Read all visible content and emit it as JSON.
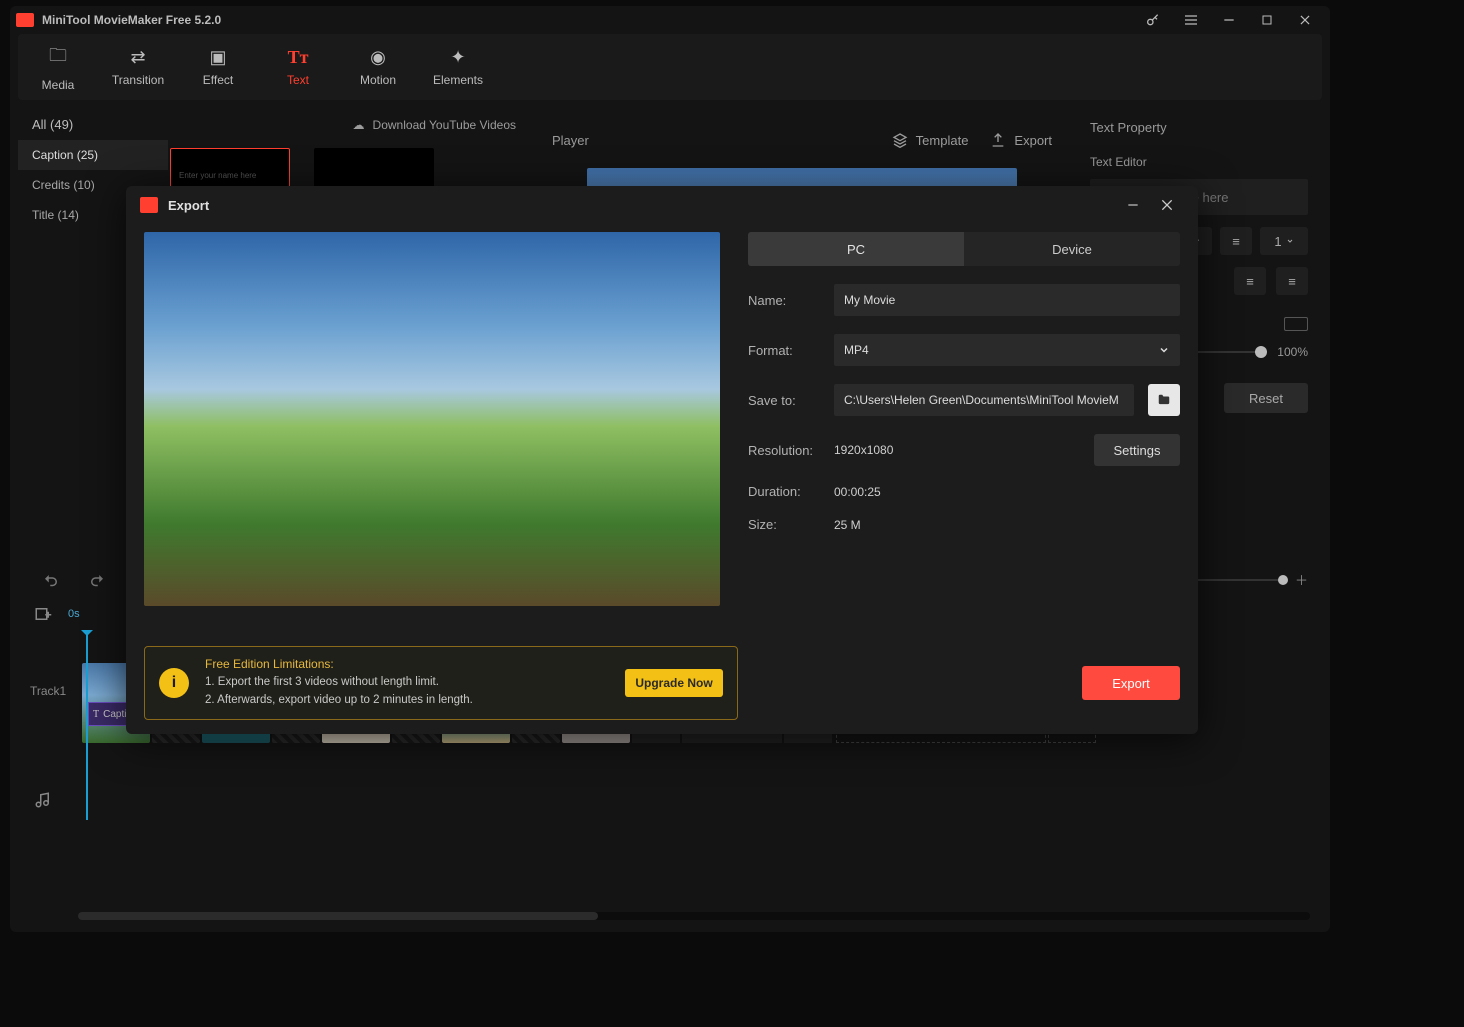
{
  "title": "MiniTool MovieMaker Free 5.2.0",
  "toolbar": {
    "items": [
      {
        "label": "Media"
      },
      {
        "label": "Transition"
      },
      {
        "label": "Effect"
      },
      {
        "label": "Text",
        "active": true
      },
      {
        "label": "Motion"
      },
      {
        "label": "Elements"
      }
    ]
  },
  "left": {
    "all": "All (49)",
    "download": "Download YouTube Videos",
    "cats": [
      {
        "label": "Caption (25)",
        "active": true
      },
      {
        "label": "Credits (10)"
      },
      {
        "label": "Title (14)"
      }
    ],
    "thumb_placeholder": "Enter your name here"
  },
  "player": {
    "label": "Player",
    "template": "Template",
    "export": "Export"
  },
  "right": {
    "title": "Text Property",
    "editor": "Text Editor",
    "placeholder": "Enter Your name here",
    "opacity": "100%",
    "line": "1",
    "reset": "Reset"
  },
  "timeline": {
    "time": "0s",
    "track": "Track1",
    "caption": "Capti"
  },
  "modal": {
    "title": "Export",
    "tabs": {
      "pc": "PC",
      "device": "Device"
    },
    "name_label": "Name:",
    "name": "My Movie",
    "format_label": "Format:",
    "format": "MP4",
    "save_label": "Save to:",
    "save": "C:\\Users\\Helen Green\\Documents\\MiniTool MovieM",
    "res_label": "Resolution:",
    "res": "1920x1080",
    "settings": "Settings",
    "dur_label": "Duration:",
    "dur": "00:00:25",
    "size_label": "Size:",
    "size": "25 M",
    "limit_h": "Free Edition Limitations:",
    "limit_1": "1. Export the first 3 videos without length limit.",
    "limit_2": "2. Afterwards, export video up to 2 minutes in length.",
    "upgrade": "Upgrade Now",
    "export": "Export"
  }
}
